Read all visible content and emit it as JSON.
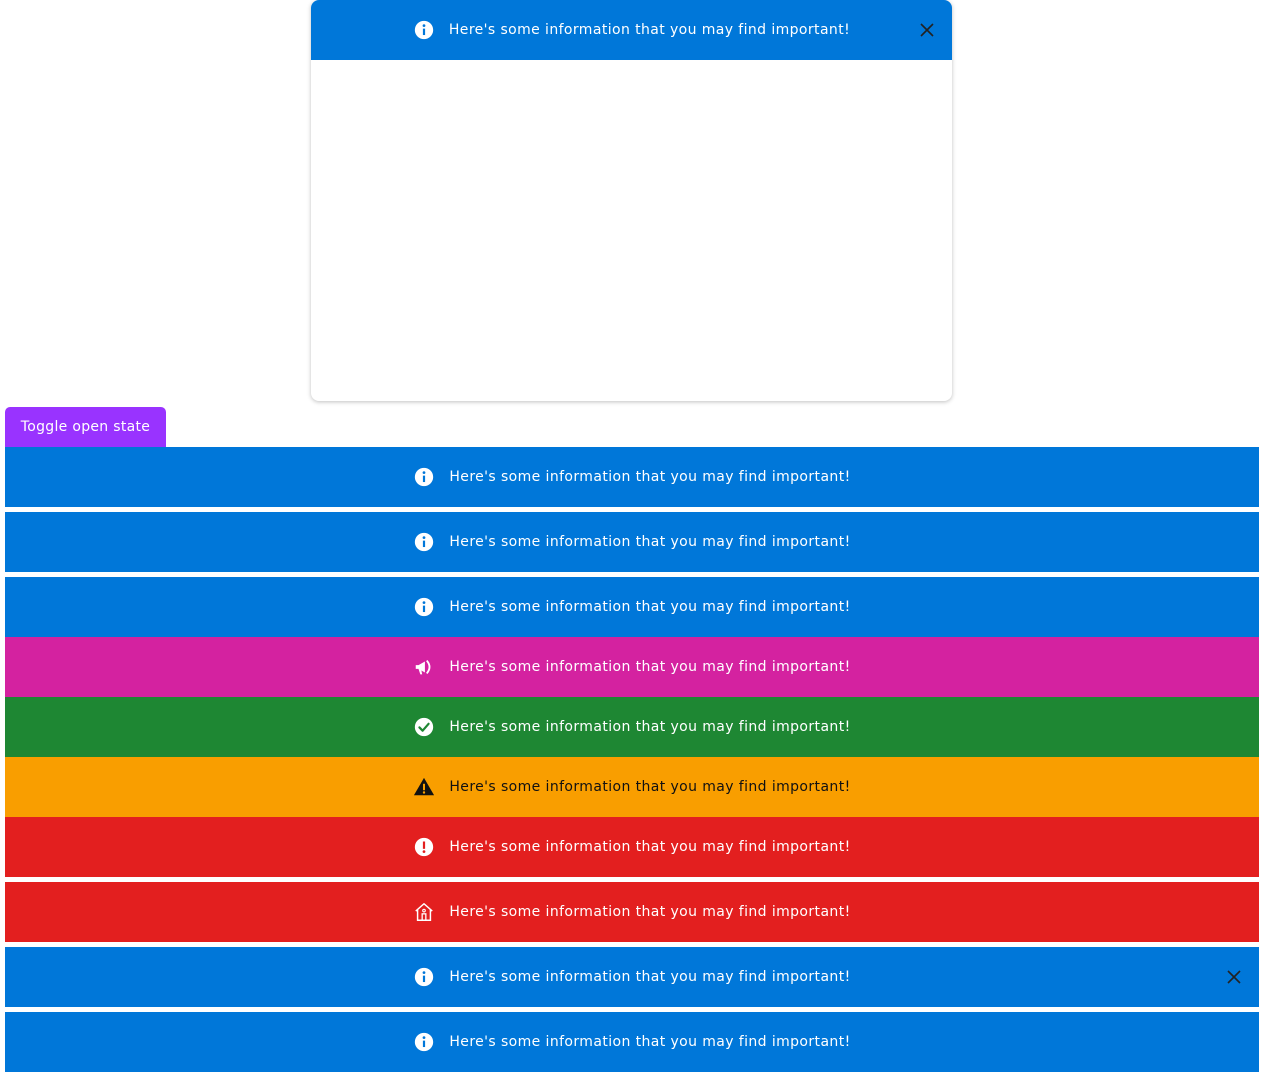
{
  "message": "Here's some information that you may find important!",
  "toggle_button": {
    "label": "Toggle open state"
  },
  "dialog": {
    "banner": {
      "message": "Here's some information that you may find important!",
      "icon": "info-icon",
      "closable": true
    }
  },
  "banners": [
    {
      "variant": "info",
      "icon": "info-icon",
      "message": "Here's some information that you may find important!",
      "closable": false
    },
    {
      "variant": "info",
      "icon": "info-icon",
      "message": "Here's some information that you may find important!",
      "closable": false
    },
    {
      "variant": "info",
      "icon": "info-icon",
      "message": "Here's some information that you may find important!",
      "closable": false
    },
    {
      "variant": "promo",
      "icon": "megaphone-icon",
      "message": "Here's some information that you may find important!",
      "closable": false
    },
    {
      "variant": "success",
      "icon": "check-circle-icon",
      "message": "Here's some information that you may find important!",
      "closable": false
    },
    {
      "variant": "warning",
      "icon": "warning-triangle-icon",
      "message": "Here's some information that you may find important!",
      "closable": false
    },
    {
      "variant": "error",
      "icon": "error-circle-icon",
      "message": "Here's some information that you may find important!",
      "closable": false
    },
    {
      "variant": "error",
      "icon": "house-icon",
      "message": "Here's some information that you may find important!",
      "closable": false
    },
    {
      "variant": "info",
      "icon": "info-icon",
      "message": "Here's some information that you may find important!",
      "closable": true
    },
    {
      "variant": "info",
      "icon": "info-icon",
      "message": "Here's some information that you may find important!",
      "closable": false
    }
  ],
  "colors": {
    "info": "#0077d9",
    "promo": "#d422a0",
    "success": "#1e8733",
    "warning": "#f99e00",
    "error": "#e31f1f",
    "toggle_button": "#9933ff"
  }
}
